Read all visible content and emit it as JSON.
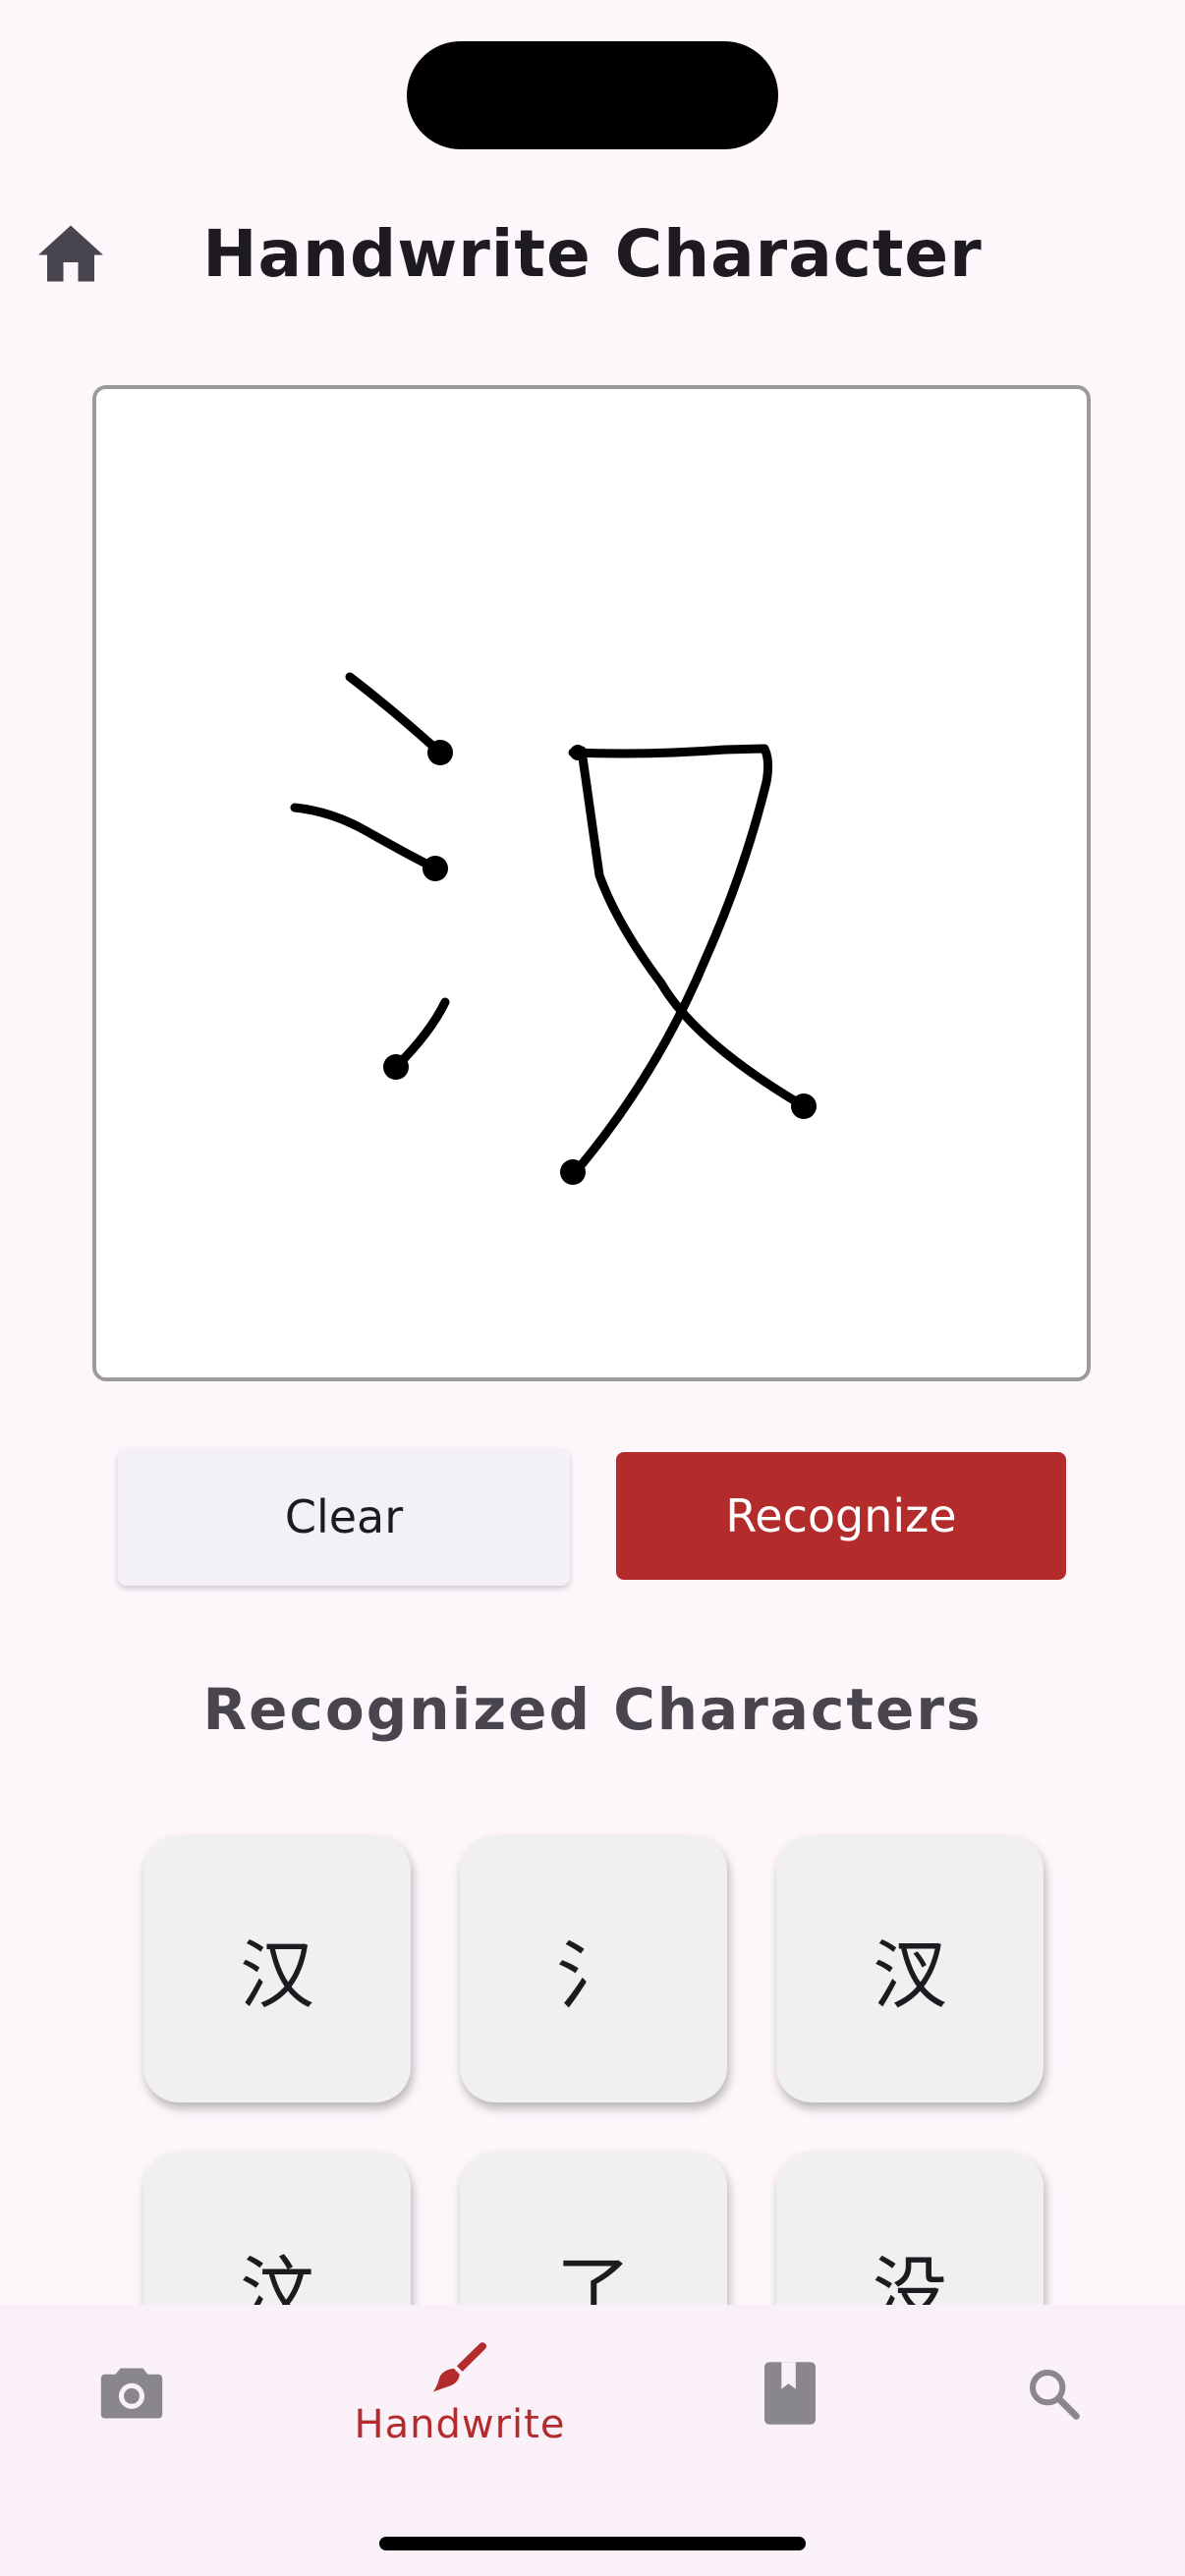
{
  "header": {
    "title": "Handwrite Character",
    "home_icon": "home-icon"
  },
  "actions": {
    "clear_label": "Clear",
    "recognize_label": "Recognize"
  },
  "results": {
    "title": "Recognized Characters",
    "characters": [
      "汉",
      "氵",
      "汊",
      "汶",
      "了",
      "没"
    ]
  },
  "bottom_nav": {
    "items": [
      {
        "icon": "camera-icon",
        "label": ""
      },
      {
        "icon": "brush-icon",
        "label": "Handwrite",
        "active": true
      },
      {
        "icon": "book-icon",
        "label": ""
      },
      {
        "icon": "search-icon",
        "label": ""
      }
    ]
  },
  "colors": {
    "accent": "#b32b2b",
    "background": "#fdf7fc",
    "tile": "#f1f0f1",
    "inactive_icon": "#8a878c"
  }
}
